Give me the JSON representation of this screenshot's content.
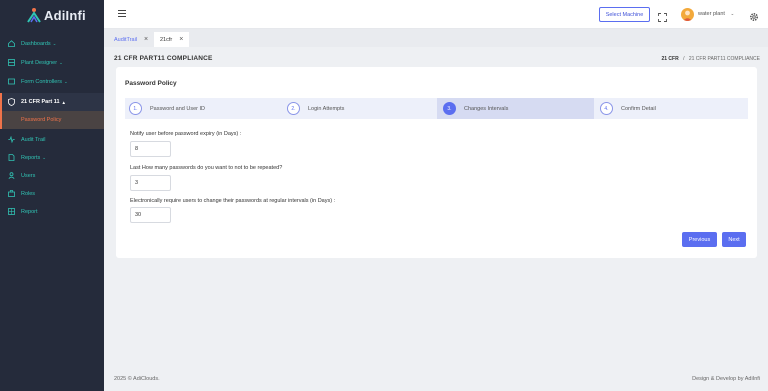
{
  "app": {
    "logo_text": "AdiInfi",
    "brand_color": "#252b3b",
    "accent_color": "#5b6ef0",
    "nav_color": "#31c4b4",
    "active_color": "#f0734a"
  },
  "sidebar": {
    "items": [
      {
        "label": "Dashboards",
        "icon": "dashboard-icon",
        "chevron": "⌄"
      },
      {
        "label": "Plant Designer",
        "icon": "layers-icon",
        "chevron": "⌄"
      },
      {
        "label": "Form Controllers",
        "icon": "form-icon",
        "chevron": "⌄"
      },
      {
        "label": "21 CFR Part 11",
        "icon": "shield-icon",
        "chevron": "▲"
      },
      {
        "label": "Password Policy",
        "icon": "",
        "chevron": ""
      },
      {
        "label": "Audit Trail",
        "icon": "activity-icon",
        "chevron": ""
      },
      {
        "label": "Reports",
        "icon": "document-icon",
        "chevron": "⌄"
      },
      {
        "label": "Users",
        "icon": "users-icon",
        "chevron": ""
      },
      {
        "label": "Roles",
        "icon": "roles-icon",
        "chevron": ""
      },
      {
        "label": "Report",
        "icon": "grid-icon",
        "chevron": ""
      }
    ]
  },
  "topbar": {
    "select_machine": "Select Machine",
    "user_name": "water plant",
    "user_chevron": "⌄"
  },
  "tabs": [
    {
      "label": "AuditTrail",
      "close": "×"
    },
    {
      "label": "21cfr",
      "close": "×"
    }
  ],
  "page": {
    "title": "21 CFR PART11 COMPLIANCE",
    "breadcrumb_root": "21 CFR",
    "breadcrumb_sep": "/",
    "breadcrumb_current": "21 CFR PART11 COMPLIANCE"
  },
  "card": {
    "title": "Password Policy",
    "steps": [
      {
        "num": "1.",
        "label": "Password and User ID"
      },
      {
        "num": "2.",
        "label": "Login Attempts"
      },
      {
        "num": "3.",
        "label": "Changes Intervals"
      },
      {
        "num": "4.",
        "label": "Confirm Detail"
      }
    ],
    "active_step": 3,
    "fields": [
      {
        "label": "Notify user before password expiry (in Days) :",
        "value": "8"
      },
      {
        "label": "Last How many passwords do you want to not to be repeated?",
        "value": "3"
      },
      {
        "label": "Electronically require users to change their passwords at regular intervals (in Days) :",
        "value": "30"
      }
    ],
    "previous_label": "Previous",
    "next_label": "Next"
  },
  "footer": {
    "left": "2025 © AdiClouds.",
    "right": "Design & Develop by AdiInfi"
  }
}
